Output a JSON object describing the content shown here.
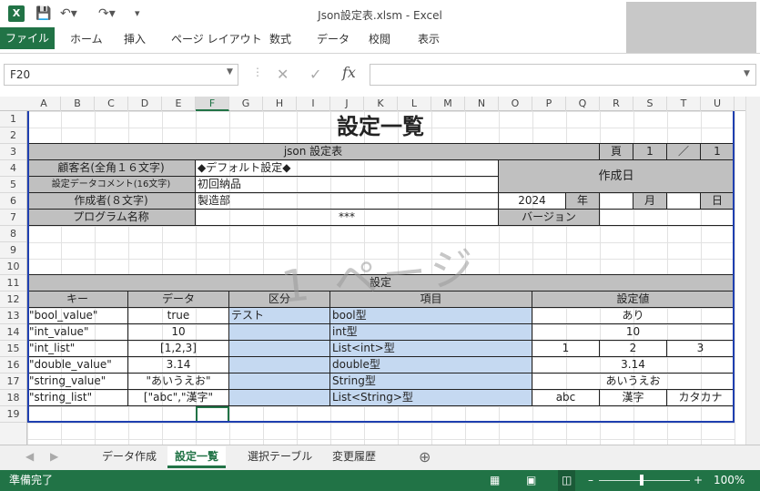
{
  "window": {
    "title": "Json設定表.xlsm - Excel",
    "icon": "X"
  },
  "ribbon": {
    "tabs": [
      "ファイル",
      "ホーム",
      "挿入",
      "ページ レイアウト",
      "数式",
      "データ",
      "校閲",
      "表示"
    ]
  },
  "formula_bar": {
    "name_box": "F20",
    "fx": "fx",
    "value": ""
  },
  "columns": [
    "A",
    "B",
    "C",
    "D",
    "E",
    "F",
    "G",
    "H",
    "I",
    "J",
    "K",
    "L",
    "M",
    "N",
    "O",
    "P",
    "Q",
    "R",
    "S",
    "T",
    "U"
  ],
  "selected_column": "F",
  "rows": [
    "1",
    "2",
    "3",
    "4",
    "5",
    "6",
    "7",
    "8",
    "9",
    "10",
    "11",
    "12",
    "13",
    "14",
    "15",
    "16",
    "17",
    "18",
    "19"
  ],
  "sheet": {
    "title": "設定一覧",
    "subtitle": "json 設定表",
    "page_label": "頁",
    "page_num": "1",
    "page_sep": "／",
    "page_total": "1",
    "customer_label": "顧客名(全角１６文字)",
    "customer_value": "◆デフォルト設定◆",
    "comment_label": "設定データコメント(16文字)",
    "comment_value": "初回納品",
    "creator_label": "作成者(８文字)",
    "creator_value": "製造部",
    "created_label": "作成日",
    "year": "2024",
    "year_label": "年",
    "month_label": "月",
    "day_label": "日",
    "program_label": "プログラム名称",
    "program_value": "***",
    "version_label": "バージョン",
    "watermark": "1 ページ",
    "section": "設定",
    "headers": {
      "key": "キー",
      "data": "データ",
      "kubun": "区分",
      "item": "項目",
      "setting": "設定値"
    },
    "rows": [
      {
        "key": "\"bool_value\"",
        "data": "true",
        "kubun": "テスト",
        "item": "bool型",
        "v1": "あり"
      },
      {
        "key": "\"int_value\"",
        "data": "10",
        "kubun": "",
        "item": "int型",
        "v1": "10"
      },
      {
        "key": "\"int_list\"",
        "data": "[1,2,3]",
        "kubun": "",
        "item": "List<int>型",
        "v1": "1",
        "v2": "2",
        "v3": "3"
      },
      {
        "key": "\"double_value\"",
        "data": "3.14",
        "kubun": "",
        "item": "double型",
        "v1": "3.14"
      },
      {
        "key": "\"string_value\"",
        "data": "\"あいうえお\"",
        "kubun": "",
        "item": "String型",
        "v1": "あいうえお"
      },
      {
        "key": "\"string_list\"",
        "data": "[\"abc\",\"漢字\"",
        "kubun": "",
        "item": "List<String>型",
        "v1": "abc",
        "v2": "漢字",
        "v3": "カタカナ"
      }
    ]
  },
  "sheet_tabs": [
    "データ作成",
    "設定一覧",
    "選択テーブル",
    "変更履歴"
  ],
  "active_tab": "設定一覧",
  "status": {
    "ready": "準備完了",
    "zoom": "100%"
  }
}
